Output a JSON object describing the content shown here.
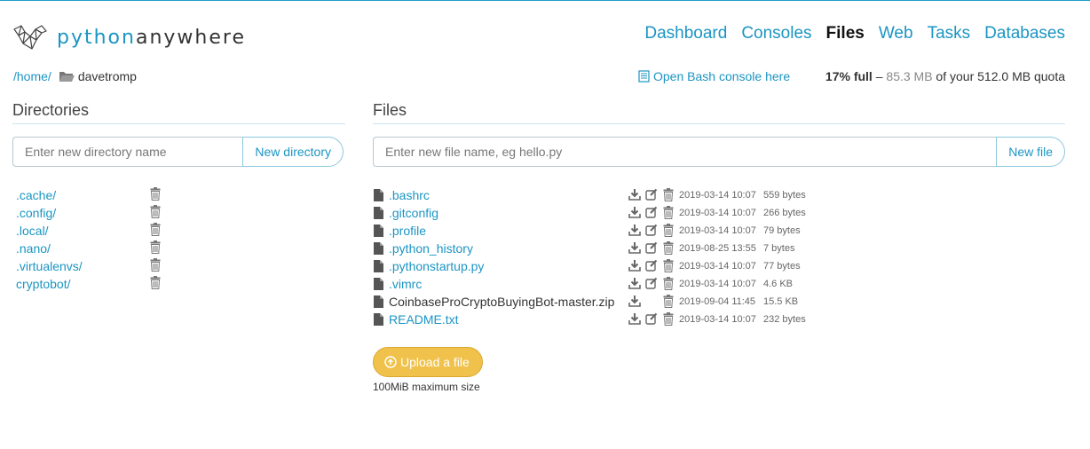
{
  "brand": {
    "python": "python",
    "anywhere": "anywhere"
  },
  "nav": [
    {
      "label": "Dashboard",
      "active": false
    },
    {
      "label": "Consoles",
      "active": false
    },
    {
      "label": "Files",
      "active": true
    },
    {
      "label": "Web",
      "active": false
    },
    {
      "label": "Tasks",
      "active": false
    },
    {
      "label": "Databases",
      "active": false
    }
  ],
  "breadcrumb": {
    "root": "/home/",
    "user": "davetromp"
  },
  "bash_link": "Open Bash console here",
  "quota": {
    "percent": "17% full",
    "dash": " – ",
    "used": "85.3 MB",
    "of": " of your ",
    "total": "512.0 MB quota"
  },
  "directories": {
    "title": "Directories",
    "input_placeholder": "Enter new directory name",
    "button": "New directory",
    "items": [
      ".cache/",
      ".config/",
      ".local/",
      ".nano/",
      ".virtualenvs/",
      "cryptobot/"
    ]
  },
  "files": {
    "title": "Files",
    "input_placeholder": "Enter new file name, eg hello.py",
    "button": "New file",
    "items": [
      {
        "name": ".bashrc",
        "date": "2019-03-14 10:07",
        "size": "559 bytes",
        "editable": true
      },
      {
        "name": ".gitconfig",
        "date": "2019-03-14 10:07",
        "size": "266 bytes",
        "editable": true
      },
      {
        "name": ".profile",
        "date": "2019-03-14 10:07",
        "size": "79 bytes",
        "editable": true
      },
      {
        "name": ".python_history",
        "date": "2019-08-25 13:55",
        "size": "7 bytes",
        "editable": true
      },
      {
        "name": ".pythonstartup.py",
        "date": "2019-03-14 10:07",
        "size": "77 bytes",
        "editable": true
      },
      {
        "name": ".vimrc",
        "date": "2019-03-14 10:07",
        "size": "4.6 KB",
        "editable": true
      },
      {
        "name": "CoinbaseProCryptoBuyingBot-master.zip",
        "date": "2019-09-04 11:45",
        "size": "15.5 KB",
        "editable": false
      },
      {
        "name": "README.txt",
        "date": "2019-03-14 10:07",
        "size": "232 bytes",
        "editable": true
      }
    ]
  },
  "upload": {
    "label": "Upload a file",
    "note": "100MiB maximum size"
  },
  "colors": {
    "accent": "#1b95c3",
    "upload": "#f0c24b"
  }
}
